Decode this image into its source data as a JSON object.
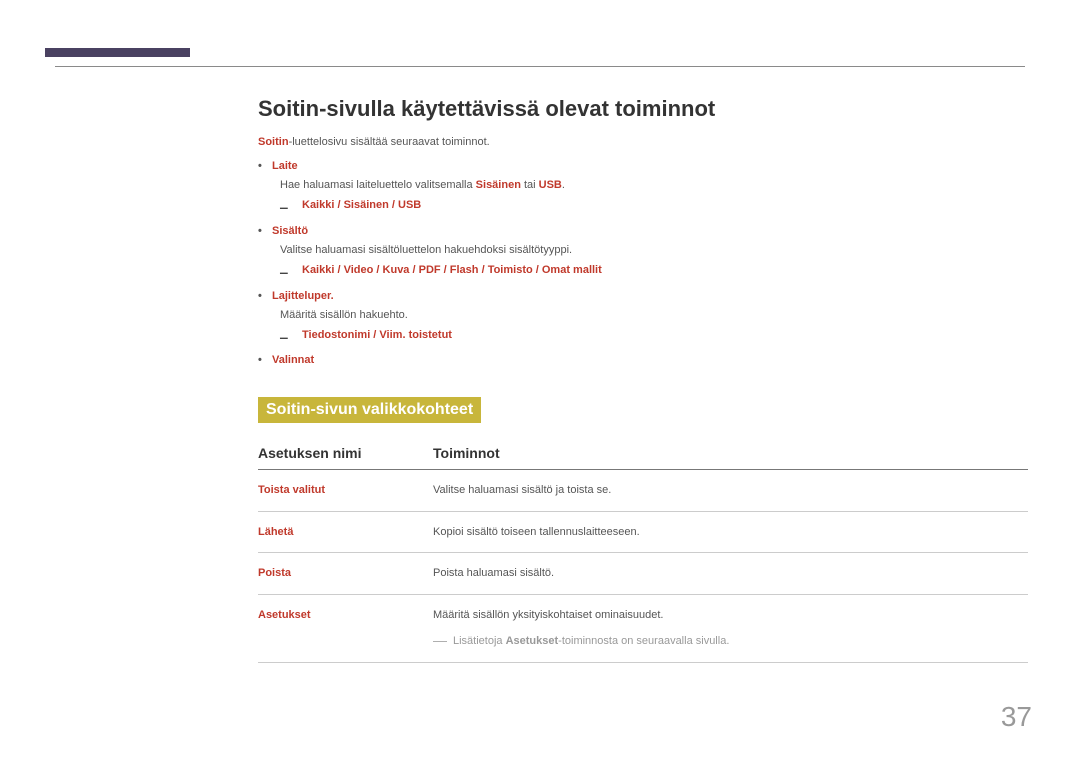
{
  "page_number": "37",
  "main": {
    "title": "Soitin-sivulla käytettävissä olevat toiminnot",
    "intro_prefix_bold": "Soitin",
    "intro_rest": "-luettelosivu sisältää seuraavat toiminnot.",
    "items": [
      {
        "label": "Laite",
        "desc_pre": "Hae haluamasi laiteluettelo valitsemalla ",
        "desc_bold1": "Sisäinen",
        "desc_mid": " tai ",
        "desc_bold2": "USB",
        "desc_post": ".",
        "sub": [
          "Kaikki",
          "Sisäinen",
          "USB"
        ]
      },
      {
        "label": "Sisältö",
        "desc_plain": "Valitse haluamasi sisältöluettelon hakuehdoksi sisältötyyppi.",
        "sub": [
          "Kaikki",
          "Video",
          "Kuva",
          "PDF",
          "Flash",
          "Toimisto",
          "Omat mallit"
        ]
      },
      {
        "label": "Lajitteluper.",
        "desc_plain": "Määritä sisällön hakuehto.",
        "sub": [
          "Tiedostonimi",
          "Viim. toistetut"
        ]
      },
      {
        "label": "Valinnat"
      }
    ]
  },
  "section2": {
    "heading": "Soitin-sivun valikkokohteet",
    "col_name": "Asetuksen nimi",
    "col_func": "Toiminnot",
    "rows": [
      {
        "name": "Toista valitut",
        "func": "Valitse haluamasi sisältö ja toista se."
      },
      {
        "name": "Lähetä",
        "func": "Kopioi sisältö toiseen tallennuslaitteeseen."
      },
      {
        "name": "Poista",
        "func": "Poista haluamasi sisältö."
      },
      {
        "name": "Asetukset",
        "func": "Määritä sisällön yksityiskohtaiset ominaisuudet.",
        "note_pre": "Lisätietoja ",
        "note_bold": "Asetukset",
        "note_post": "-toiminnosta on seuraavalla sivulla."
      }
    ]
  }
}
